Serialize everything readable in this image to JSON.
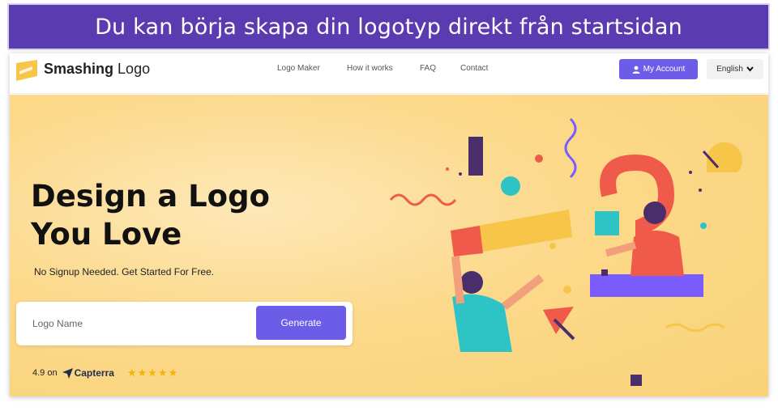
{
  "banner": {
    "text": "Du kan börja skapa din logotyp direkt från startsidan"
  },
  "brand": {
    "name_bold": "Smashing",
    "name_light": "Logo",
    "accent": "#6c5ce7"
  },
  "nav": {
    "links": [
      "Logo Maker",
      "How it works",
      "FAQ",
      "Contact"
    ],
    "account_label": "My Account",
    "language_label": "English"
  },
  "hero": {
    "headline_line1": "Design a Logo",
    "headline_line2": "You Love",
    "subheadline": "No Signup Needed. Get Started For Free.",
    "input_placeholder": "Logo Name",
    "generate_label": "Generate",
    "rating_value": "4.9 on",
    "rating_source": "Capterra",
    "stars": "★★★★★"
  },
  "icons": {
    "account": "user-icon",
    "language": "caret-down-icon",
    "capterra": "capterra-arrow-icon",
    "logo": "smashing-logo-icon"
  }
}
